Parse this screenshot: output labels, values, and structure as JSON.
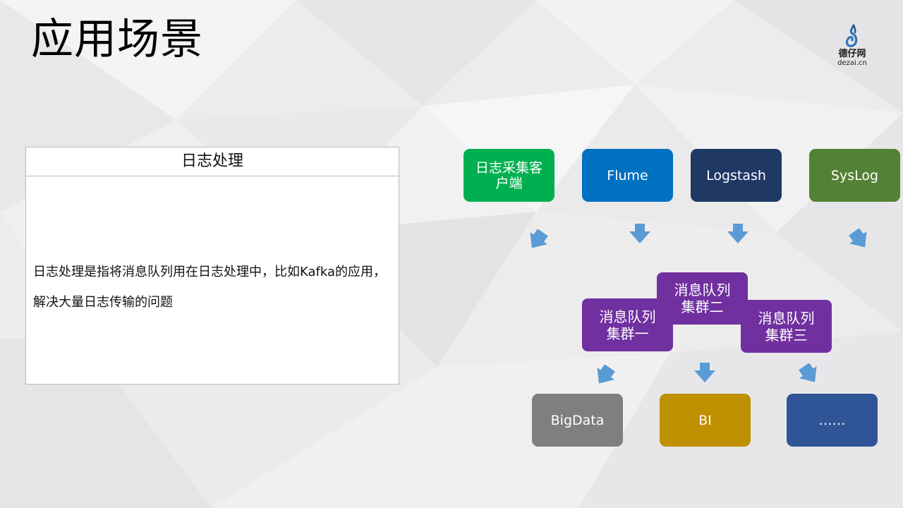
{
  "title": "应用场景",
  "logo": {
    "name_cn": "德仔网",
    "domain": "dezai.cn"
  },
  "info_box": {
    "header": "日志处理",
    "body_line1": "日志处理是指将消息队列用在日志处理中，比如Kafka的应用，",
    "body_line2": "解决大量日志传输的问题"
  },
  "diagram": {
    "sources": [
      {
        "label": "日志采集客户端",
        "color": "#00b050"
      },
      {
        "label": "Flume",
        "color": "#0070c0"
      },
      {
        "label": "Logstash",
        "color": "#1f3864"
      },
      {
        "label": "SysLog",
        "color": "#548235"
      }
    ],
    "queues": [
      {
        "label": "消息队列集群一",
        "color": "#7030a0"
      },
      {
        "label": "消息队列集群二",
        "color": "#7030a0"
      },
      {
        "label": "消息队列集群三",
        "color": "#7030a0"
      }
    ],
    "sinks": [
      {
        "label": "BigData",
        "color": "#7f7f7f"
      },
      {
        "label": "BI",
        "color": "#bf9000"
      },
      {
        "label": "……",
        "color": "#2f5597"
      }
    ],
    "arrow_color": "#5b9bd5"
  }
}
